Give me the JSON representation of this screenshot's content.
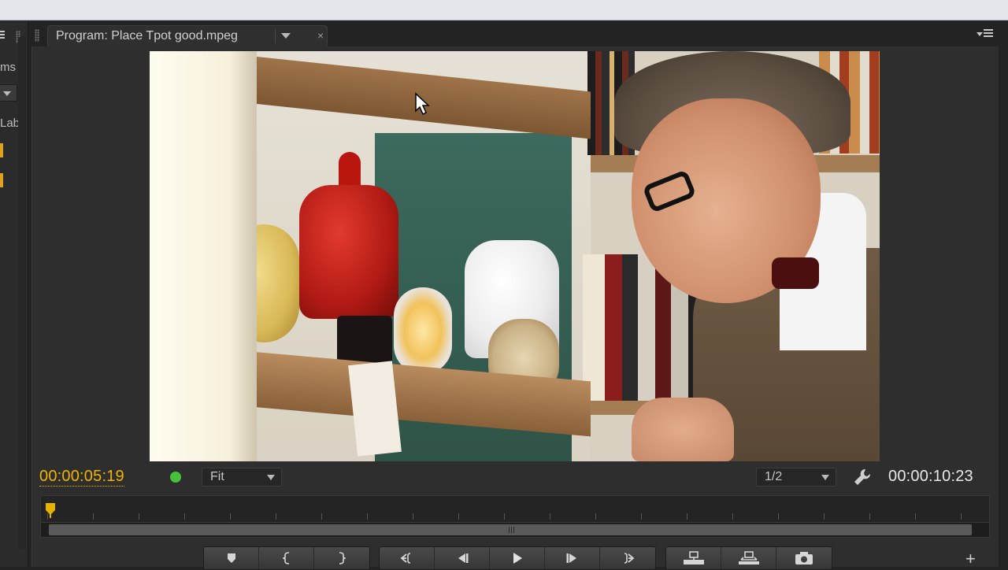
{
  "left_panel": {
    "text_top": "ms",
    "text_mid": "Lab"
  },
  "tab": {
    "title": "Program: Place Tpot good.mpeg",
    "close": "×"
  },
  "controls": {
    "current_timecode": "00:00:05:19",
    "duration_timecode": "00:00:10:23",
    "zoom_value": "Fit",
    "resolution_value": "1/2"
  },
  "colors": {
    "timecode_accent": "#f0b400",
    "status_dot": "#46c23a"
  },
  "transport_icons": [
    "add-marker-icon",
    "mark-in-icon",
    "mark-out-icon",
    "go-to-in-icon",
    "step-back-icon",
    "play-icon",
    "step-forward-icon",
    "go-to-out-icon",
    "lift-icon",
    "extract-icon",
    "export-frame-icon"
  ],
  "plus": "+"
}
